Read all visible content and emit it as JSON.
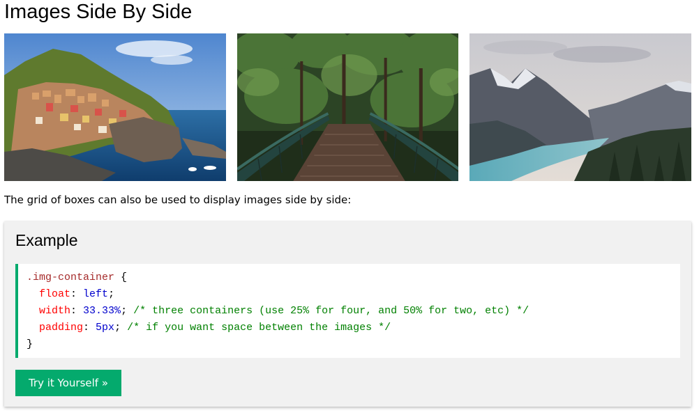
{
  "page_title": "Images Side By Side",
  "images": [
    {
      "subject": "cinque-terre-coastal-village"
    },
    {
      "subject": "forest-bridge"
    },
    {
      "subject": "mountains-lake"
    }
  ],
  "intro_text": "The grid of boxes can also be used to display images side by side:",
  "example": {
    "heading": "Example",
    "code": {
      "selector": ".img-container",
      "open_brace": " {",
      "close_brace": "}",
      "declarations": [
        {
          "property": "float",
          "value": "left",
          "comment": ""
        },
        {
          "property": "width",
          "value": "33.33%",
          "comment": "/* three containers (use 25% for four, and 50% for two, etc) */"
        },
        {
          "property": "padding",
          "value": "5px",
          "comment": "/* if you want space between the images */"
        }
      ]
    },
    "button_label": "Try it Yourself »"
  },
  "colors": {
    "accent": "#04aa6d",
    "example_bg": "#f1f1f1",
    "code_selector": "#a52a2a",
    "code_property": "#ff0000",
    "code_value": "#0000cd",
    "code_comment": "#008000"
  }
}
